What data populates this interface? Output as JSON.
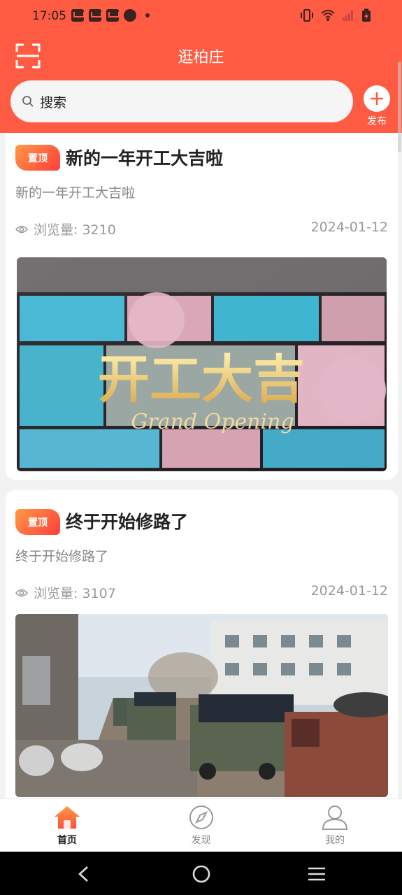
{
  "status": {
    "time": "17:05",
    "icons": [
      "mail-notification-icon",
      "mail-notification-icon",
      "mail-notification-icon",
      "compass-notification-icon",
      "more-dot-icon",
      "vibrate-icon",
      "wifi-icon",
      "signal-icon",
      "battery-charging-icon"
    ]
  },
  "header": {
    "title": "逛柏庄",
    "scan_icon": "scan-icon",
    "search_placeholder": "搜索",
    "publish_label": "发布"
  },
  "posts": [
    {
      "badge": "置顶",
      "title": "新的一年开工大吉啦",
      "summary": "新的一年开工大吉啦",
      "views_label": "浏览量: 3210",
      "date": "2024-01-12",
      "image": {
        "headline": "开工大吉",
        "caption": "Grand Opening"
      }
    },
    {
      "badge": "置顶",
      "title": "终于开始修路了",
      "summary": "终于开始修路了",
      "views_label": "浏览量: 3107",
      "date": "2024-01-12"
    }
  ],
  "tabs": [
    {
      "label": "首页",
      "icon": "home-icon",
      "active": true
    },
    {
      "label": "发现",
      "icon": "compass-icon",
      "active": false
    },
    {
      "label": "我的",
      "icon": "user-icon",
      "active": false
    }
  ],
  "colors": {
    "brand": "#ff5a42",
    "badge_from": "#ff9a44",
    "badge_to": "#ff3d3d"
  }
}
